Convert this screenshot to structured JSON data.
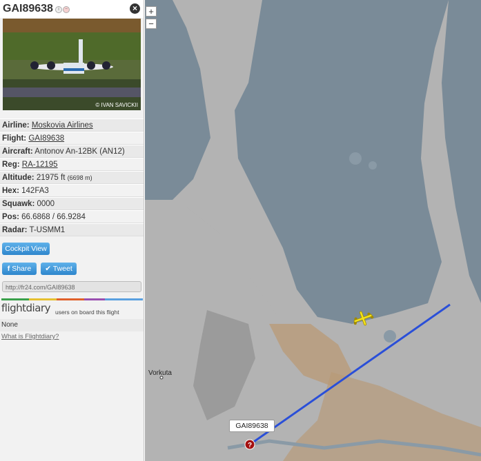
{
  "header": {
    "title": "GAI89638"
  },
  "photo": {
    "credit": "© IVAN SAVICKII"
  },
  "info": [
    {
      "label": "Airline:",
      "value": "Moskovia Airlines",
      "link": true
    },
    {
      "label": "Flight:",
      "value": "GAI89638",
      "link": true
    },
    {
      "label": "Aircraft:",
      "value": "Antonov An-12BK (AN12)",
      "link": false
    },
    {
      "label": "Reg:",
      "value": "RA-12195",
      "link": true
    },
    {
      "label": "Altitude:",
      "value": "21975 ft",
      "extra": "(6698 m)",
      "link": false
    },
    {
      "label": "Hex:",
      "value": "142FA3",
      "link": false
    },
    {
      "label": "Squawk:",
      "value": "0000",
      "link": false
    },
    {
      "label": "Pos:",
      "value": "66.6868 / 66.9284",
      "link": false
    },
    {
      "label": "Radar:",
      "value": "T-USMM1",
      "link": false
    }
  ],
  "buttons": {
    "cockpit": "Cockpit View",
    "share": "Share",
    "tweet": "Tweet"
  },
  "url": "http://fr24.com/GAI89638",
  "flightdiary": {
    "logo": "flightdiary",
    "text": "users on board this flight",
    "none": "None",
    "what": "What is Flightdiary?"
  },
  "map": {
    "zoom_in": "+",
    "zoom_out": "−",
    "city": "Vorkuta",
    "flight_label": "GAI89638"
  },
  "colors": {
    "accent": "#2e86cc",
    "track": "#2a4fd8",
    "plane": "#f2e21c",
    "water": "#7a8b98",
    "land": "#b3b3b3"
  }
}
